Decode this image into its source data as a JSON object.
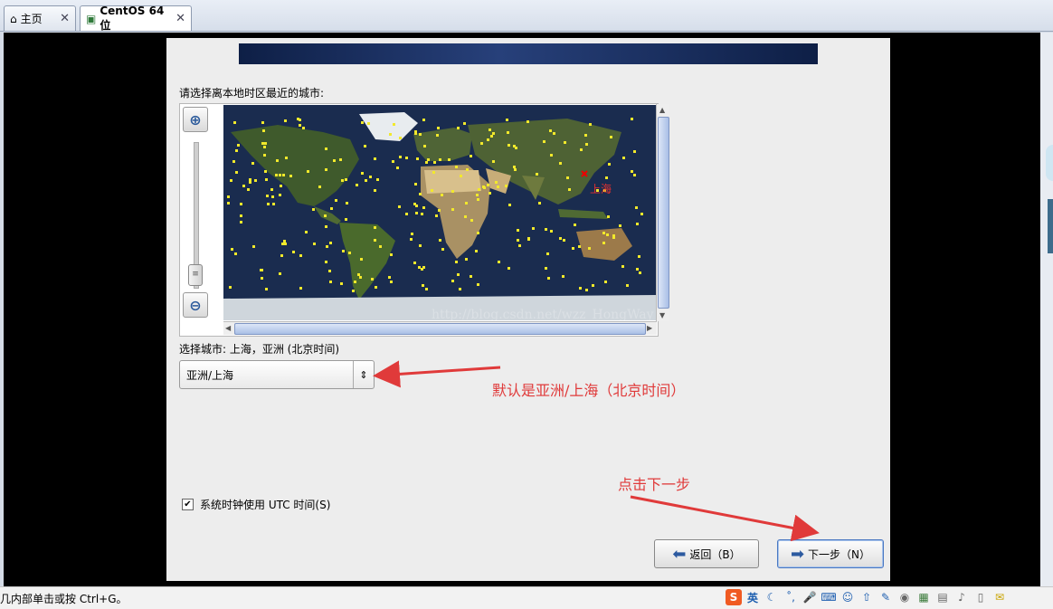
{
  "tabs": [
    {
      "label": "主页",
      "icon": "home-icon"
    },
    {
      "label": "CentOS 64 位",
      "icon": "vm-icon"
    }
  ],
  "installer": {
    "prompt": "请选择离本地时区最近的城市:",
    "map_marker_label": "上海",
    "watermark": "http://blog.csdn.net/wzz_HongWay",
    "selected_city_label": "选择城市: 上海，亚洲 (北京时间)",
    "timezone_value": "亚洲/上海",
    "utc_label": "系统时钟使用 UTC 时间(S)",
    "utc_checked": true,
    "back_label": "返回（B）",
    "next_label": "下一步（N）"
  },
  "annotations": {
    "default_note": "默认是亚洲/上海（北京时间）",
    "next_note": "点击下一步"
  },
  "statusbar": {
    "text": "几内部单击或按 Ctrl+G。",
    "ime_label": "英"
  },
  "colors": {
    "annotation": "#e03a3a",
    "map_ocean": "#1a2c4f",
    "city_dot": "#f2e92b"
  }
}
